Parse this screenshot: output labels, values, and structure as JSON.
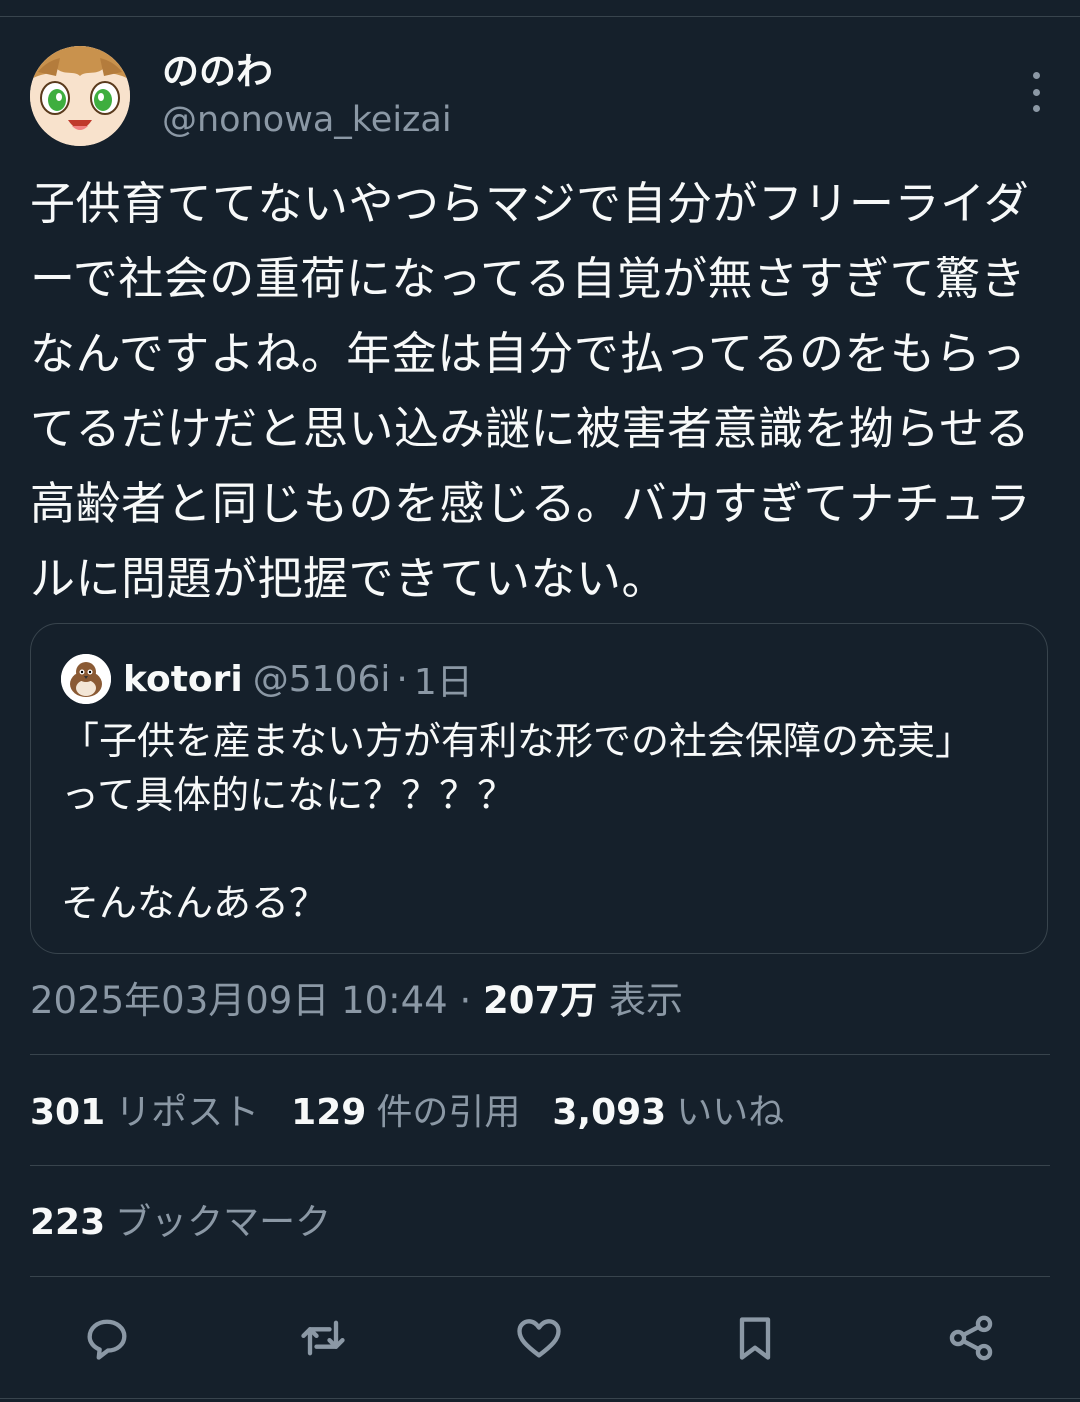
{
  "author": {
    "display_name": "ののわ",
    "handle": "@nonowa_keizai"
  },
  "tweet": {
    "text": "子供育ててないやつらマジで自分がフリーライダーで社会の重荷になってる自覚が無さすぎて驚きなんですよね。年金は自分で払ってるのをもらってるだけだと思い込み謎に被害者意識を拗らせる高齢者と同じものを感じる。バカすぎてナチュラルに問題が把握できていない。"
  },
  "quote": {
    "display_name": "kotori",
    "handle": "@5106i",
    "separator": "·",
    "time": "1日",
    "text": "「子供を産まない方が有利な形での社会保障の充実」って具体的になに？？？？\n\nそんなんある？"
  },
  "meta": {
    "datetime": "2025年03月09日 10:44",
    "separator": "·",
    "views_count": "207万",
    "views_label": "表示"
  },
  "stats": {
    "reposts_count": "301",
    "reposts_label": "リポスト",
    "quotes_count": "129",
    "quotes_label": "件の引用",
    "likes_count": "3,093",
    "likes_label": "いいね",
    "bookmarks_count": "223",
    "bookmarks_label": "ブックマーク"
  },
  "icons": {
    "more": "more-vertical-icon",
    "reply": "reply-icon",
    "repost": "repost-icon",
    "like": "heart-icon",
    "bookmark": "bookmark-icon",
    "share": "share-icon"
  },
  "colors": {
    "background": "#15202b",
    "text": "#f7f9f9",
    "secondary_text": "#8b98a5",
    "divider": "#38444d"
  }
}
